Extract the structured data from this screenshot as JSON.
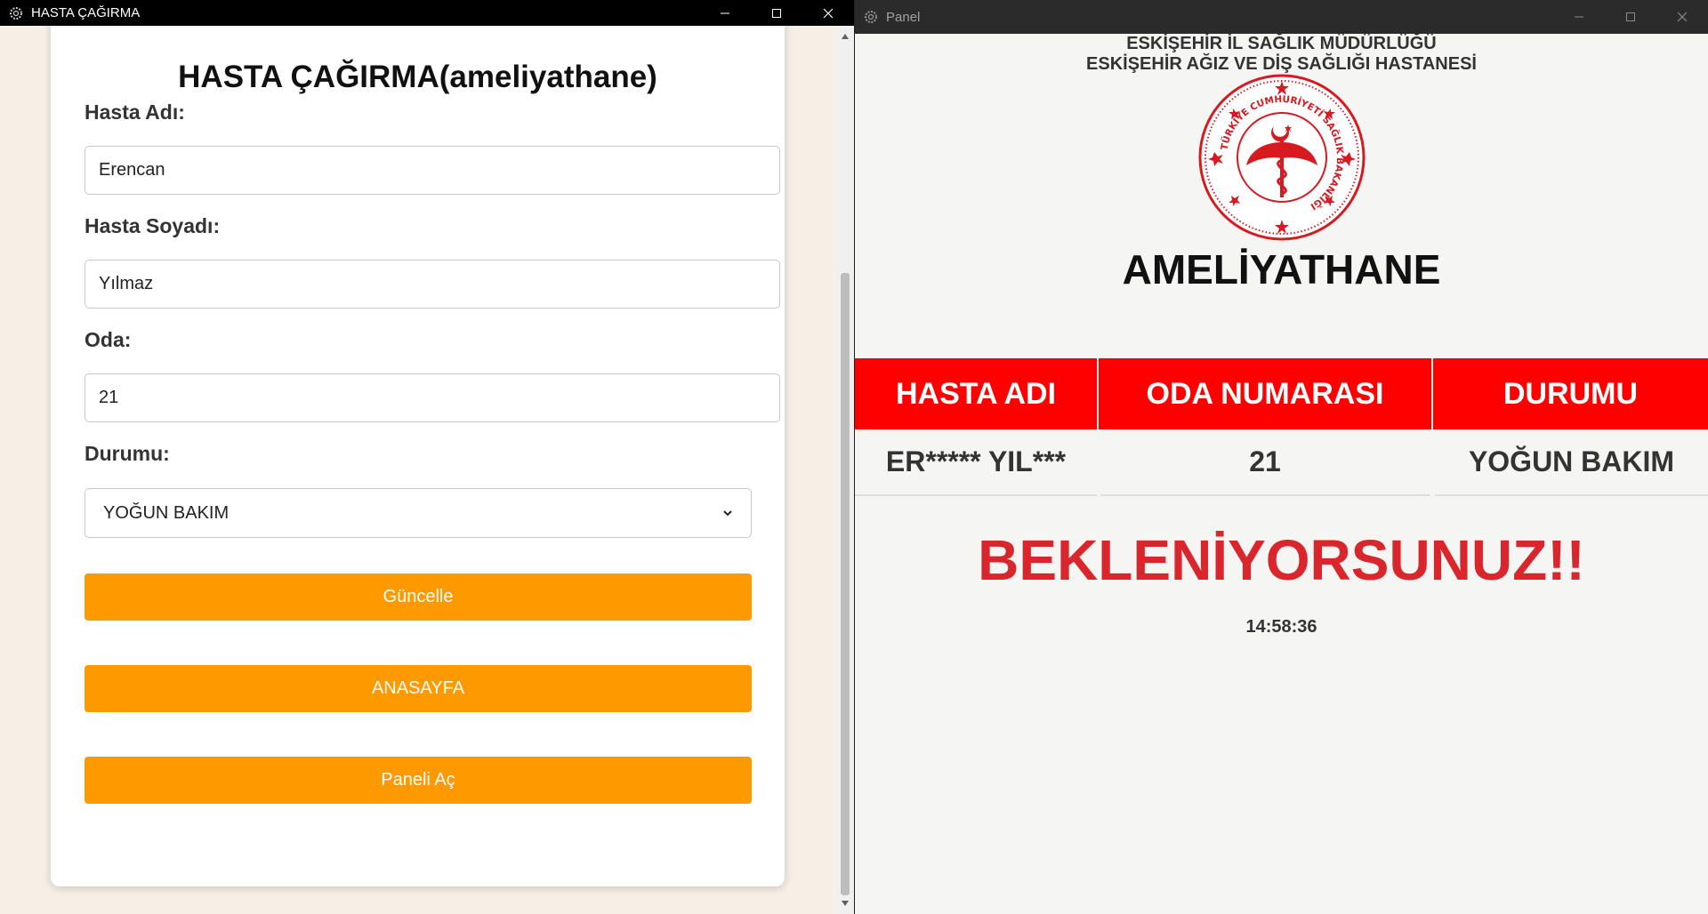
{
  "left_window": {
    "title": "HASTA ÇAĞIRMA",
    "form": {
      "title": "HASTA ÇAĞIRMA(ameliyathane)",
      "name_label": "Hasta Adı:",
      "name_value": "Erencan",
      "surname_label": "Hasta Soyadı:",
      "surname_value": "Yılmaz",
      "room_label": "Oda:",
      "room_value": "21",
      "status_label": "Durumu:",
      "status_selected": "YOĞUN BAKIM",
      "update_button": "Güncelle",
      "home_button": "ANASAYFA",
      "open_panel_button": "Paneli Aç"
    }
  },
  "right_window": {
    "title": "Panel",
    "header_line1": "ESKİŞEHİR İL SAĞLIK MÜDÜRLÜĞÜ",
    "header_line2": "ESKİŞEHİR AĞIZ VE DİŞ SAĞLIĞI HASTANESİ",
    "logo_text": "TÜRKİYE CUMHURİYETİ SAĞLIK BAKANLIĞI",
    "department": "AMELİYATHANE",
    "table": {
      "headers": [
        "HASTA ADI",
        "ODA NUMARASI",
        "DURUMU"
      ],
      "row": [
        "ER***** YIL***",
        "21",
        "YOĞUN BAKIM"
      ]
    },
    "message": "BEKLENİYORSUNUZ!!",
    "clock": "14:58:36"
  },
  "colors": {
    "header_red": "#ff0000",
    "message_red": "#d9262c",
    "button_orange": "#ff9900",
    "left_background": "#f6efe6"
  }
}
